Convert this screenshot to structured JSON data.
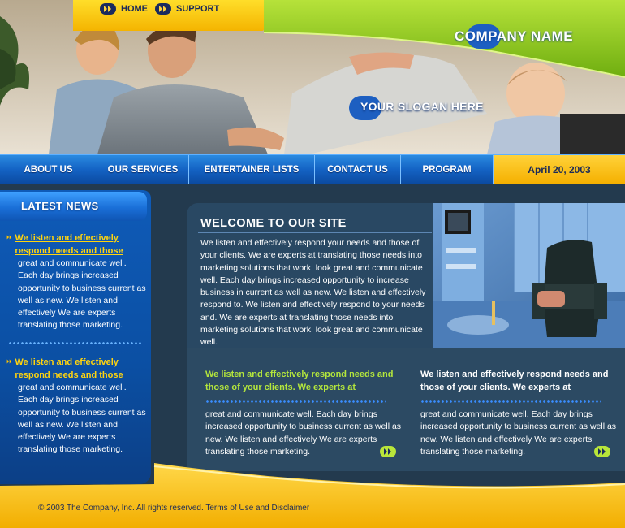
{
  "top_nav": {
    "items": [
      {
        "label": "HOME",
        "icon": "double-arrow-icon"
      },
      {
        "label": "SUPPORT",
        "icon": "double-arrow-icon"
      }
    ]
  },
  "header": {
    "company_name": "COMPANY NAME",
    "slogan": "YOUR SLOGAN HERE"
  },
  "main_nav": {
    "items": [
      "ABOUT US",
      "OUR SERVICES",
      "ENTERTAINER LISTS",
      "CONTACT US",
      "PROGRAM"
    ],
    "date": "April 20, 2003"
  },
  "sidebar": {
    "title": "LATEST NEWS",
    "news": [
      {
        "headline": "We listen and effectively respond needs and those",
        "body": "great and communicate well. Each day brings increased opportunity to business current as well as new.  We listen and effectively We are experts translating those marketing."
      },
      {
        "headline": "We listen and effectively respond needs and those",
        "body": "great and communicate well. Each day brings increased opportunity to business current as well as new.  We listen and effectively We are experts translating those marketing."
      }
    ]
  },
  "welcome": {
    "title": "WELCOME TO OUR SITE",
    "text": "We listen and effectively respond your needs and those of your clients. We are experts at  translating those needs into marketing solutions that work, look great and communicate well. Each day brings increased opportunity to increase business in current as well as new.  We listen and effectively respond to. We listen and effectively respond to your needs and. We are experts at translating those needs into marketing solutions that work, look great and communicate well."
  },
  "columns": [
    {
      "lead": "We listen and effectively respond needs and those of your clients. We experts at",
      "body": "great and communicate well. Each day brings increased opportunity to business current as well as new.  We listen and effectively We are experts translating those marketing."
    },
    {
      "lead": "We listen and effectively respond needs and those of your clients. We experts at",
      "body": "great and communicate well. Each day brings increased opportunity to business current as well as new.  We listen and effectively We are experts translating those marketing."
    }
  ],
  "footer": {
    "text": "© 2003 The Company, Inc.  All rights reserved. Terms of Use and Disclaimer"
  },
  "colors": {
    "green": "#8cc614",
    "yellow": "#f5b400",
    "blue": "#1463c4",
    "navy_bg": "#233a4e",
    "news_link": "#ffd40f",
    "lead_green": "#b4e63c"
  }
}
